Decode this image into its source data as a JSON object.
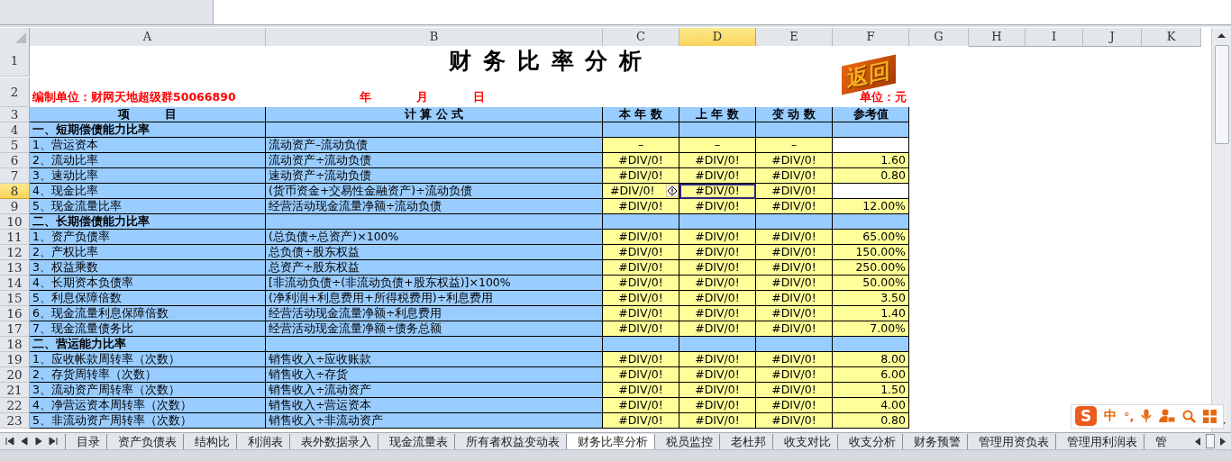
{
  "columns": [
    {
      "label": "A",
      "selected": false
    },
    {
      "label": "B",
      "selected": false
    },
    {
      "label": "C",
      "selected": false
    },
    {
      "label": "D",
      "selected": true
    },
    {
      "label": "E",
      "selected": false
    },
    {
      "label": "F",
      "selected": false
    },
    {
      "label": "G",
      "selected": false
    },
    {
      "label": "H",
      "selected": false
    },
    {
      "label": "I",
      "selected": false
    },
    {
      "label": "J",
      "selected": false
    },
    {
      "label": "K",
      "selected": false
    }
  ],
  "rows": [
    {
      "number": "1",
      "kind": "title",
      "selected": false,
      "title": "财 务 比 率 分 析",
      "return_button": "返回"
    },
    {
      "number": "2",
      "kind": "info",
      "selected": false,
      "company": "编制单位：财网天地超级群50066890",
      "date_labels": [
        "年",
        "月",
        "日"
      ],
      "unit": "单位：元"
    },
    {
      "number": "3",
      "kind": "header",
      "selected": false,
      "cells": [
        "项　　　目",
        "计 算 公 式",
        "本 年 数",
        "上 年 数",
        "变 动 数",
        "参考值"
      ]
    },
    {
      "number": "4",
      "kind": "section",
      "selected": false,
      "item": "一、短期偿债能力比率"
    },
    {
      "number": "5",
      "kind": "data",
      "selected": false,
      "item": "1、营运资本",
      "formula": "流动资产–流动负债",
      "values": [
        "–",
        "–",
        "–"
      ]
    },
    {
      "number": "6",
      "kind": "data",
      "selected": false,
      "item": "2、流动比率",
      "formula": "流动资产÷流动负债",
      "values": [
        "#DIV/0!",
        "#DIV/0!",
        "#DIV/0!"
      ],
      "reference": "1.60"
    },
    {
      "number": "7",
      "kind": "data",
      "selected": false,
      "item": "3、速动比率",
      "formula": "速动资产÷流动负债",
      "values": [
        "#DIV/0!",
        "#DIV/0!",
        "#DIV/0!"
      ],
      "reference": "0.80"
    },
    {
      "number": "8",
      "kind": "data",
      "selected": true,
      "item": "4、现金比率",
      "formula": "(货币资金+交易性金融资产)÷流动负债",
      "values": [
        "#DIV/0!",
        "#DIV/0!",
        "#DIV/0!"
      ],
      "error_icon": true
    },
    {
      "number": "9",
      "kind": "data",
      "selected": false,
      "item": "5、现金流量比率",
      "formula": "经营活动现金流量净额÷流动负债",
      "values": [
        "#DIV/0!",
        "#DIV/0!",
        "#DIV/0!"
      ],
      "reference": "12.00%"
    },
    {
      "number": "10",
      "kind": "section",
      "selected": false,
      "item": "二、长期偿债能力比率"
    },
    {
      "number": "11",
      "kind": "data",
      "selected": false,
      "item": "1、资产负债率",
      "formula": "(总负债÷总资产)×100%",
      "values": [
        "#DIV/0!",
        "#DIV/0!",
        "#DIV/0!"
      ],
      "reference": "65.00%"
    },
    {
      "number": "12",
      "kind": "data",
      "selected": false,
      "item": "2、产权比率",
      "formula": "总负债÷股东权益",
      "values": [
        "#DIV/0!",
        "#DIV/0!",
        "#DIV/0!"
      ],
      "reference": "150.00%"
    },
    {
      "number": "13",
      "kind": "data",
      "selected": false,
      "item": "3、权益乘数",
      "formula": "总资产÷股东权益",
      "values": [
        "#DIV/0!",
        "#DIV/0!",
        "#DIV/0!"
      ],
      "reference": "250.00%"
    },
    {
      "number": "14",
      "kind": "data",
      "selected": false,
      "item": "4、长期资本负债率",
      "formula": "[非流动负债÷(非流动负债+股东权益)]×100%",
      "values": [
        "#DIV/0!",
        "#DIV/0!",
        "#DIV/0!"
      ],
      "reference": "50.00%"
    },
    {
      "number": "15",
      "kind": "data",
      "selected": false,
      "item": "5、利息保障倍数",
      "formula": "(净利润+利息费用+所得税费用)÷利息费用",
      "values": [
        "#DIV/0!",
        "#DIV/0!",
        "#DIV/0!"
      ],
      "reference": "3.50"
    },
    {
      "number": "16",
      "kind": "data",
      "selected": false,
      "item": "6、现金流量利息保障倍数",
      "formula": "经营活动现金流量净额÷利息费用",
      "values": [
        "#DIV/0!",
        "#DIV/0!",
        "#DIV/0!"
      ],
      "reference": "1.40"
    },
    {
      "number": "17",
      "kind": "data",
      "selected": false,
      "item": "7、现金流量债务比",
      "formula": "经营活动现金流量净额÷债务总额",
      "values": [
        "#DIV/0!",
        "#DIV/0!",
        "#DIV/0!"
      ],
      "reference": "7.00%"
    },
    {
      "number": "18",
      "kind": "section",
      "selected": false,
      "item": "二、营运能力比率"
    },
    {
      "number": "19",
      "kind": "data",
      "selected": false,
      "item": "1、应收帐款周转率（次数）",
      "formula": "销售收入÷应收账款",
      "values": [
        "#DIV/0!",
        "#DIV/0!",
        "#DIV/0!"
      ],
      "reference": "8.00"
    },
    {
      "number": "20",
      "kind": "data",
      "selected": false,
      "item": "2、存货周转率（次数）",
      "formula": "销售收入÷存货",
      "values": [
        "#DIV/0!",
        "#DIV/0!",
        "#DIV/0!"
      ],
      "reference": "6.00"
    },
    {
      "number": "21",
      "kind": "data",
      "selected": false,
      "item": "3、流动资产周转率（次数）",
      "formula": "销售收入÷流动资产",
      "values": [
        "#DIV/0!",
        "#DIV/0!",
        "#DIV/0!"
      ],
      "reference": "1.50"
    },
    {
      "number": "22",
      "kind": "data",
      "selected": false,
      "item": "4、净营运资本周转率（次数）",
      "formula": "销售收入÷营运资本",
      "values": [
        "#DIV/0!",
        "#DIV/0!",
        "#DIV/0!"
      ],
      "reference": "4.00"
    },
    {
      "number": "23",
      "kind": "data",
      "selected": false,
      "item": "5、非流动资产周转率（次数）",
      "formula": "销售收入÷非流动资产",
      "values": [
        "#DIV/0!",
        "#DIV/0!",
        "#DIV/0!"
      ],
      "reference": "0.80"
    }
  ],
  "sheet_tabs": [
    {
      "label": "目录",
      "selected": false
    },
    {
      "label": "资产负债表",
      "selected": false
    },
    {
      "label": "结构比",
      "selected": false
    },
    {
      "label": "利润表",
      "selected": false
    },
    {
      "label": "表外数据录入",
      "selected": false
    },
    {
      "label": "现金流量表",
      "selected": false
    },
    {
      "label": "所有者权益变动表",
      "selected": false
    },
    {
      "label": "财务比率分析",
      "selected": true
    },
    {
      "label": "税员监控",
      "selected": false
    },
    {
      "label": "老杜邦",
      "selected": false
    },
    {
      "label": "收支对比",
      "selected": false
    },
    {
      "label": "收支分析",
      "selected": false
    },
    {
      "label": "财务预警",
      "selected": false
    },
    {
      "label": "管理用资负表",
      "selected": false
    },
    {
      "label": "管理用利润表",
      "selected": false
    },
    {
      "label": "管",
      "selected": false
    }
  ],
  "ime_toolbar": {
    "logo": "S",
    "mode": "中",
    "punctuation": "°,"
  }
}
